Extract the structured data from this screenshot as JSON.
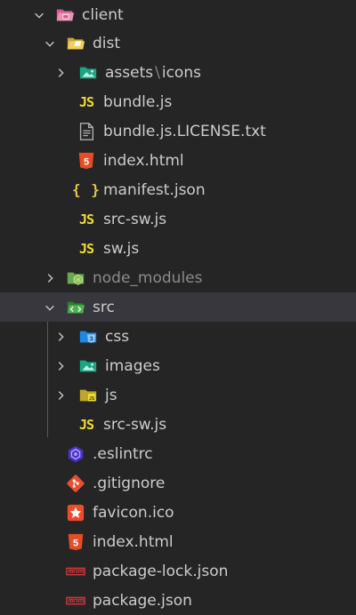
{
  "tree": {
    "client": "client",
    "dist": "dist",
    "assets_a": "assets",
    "assets_b": "icons",
    "bundle_js": "bundle.js",
    "bundle_license": "bundle.js.LICENSE.txt",
    "dist_index": "index.html",
    "manifest": "manifest.json",
    "dist_src_sw": "src-sw.js",
    "sw": "sw.js",
    "node_modules": "node_modules",
    "src": "src",
    "css": "css",
    "images": "images",
    "js": "js",
    "src_src_sw": "src-sw.js",
    "eslintrc": ".eslintrc",
    "gitignore": ".gitignore",
    "favicon": "favicon.ico",
    "index": "index.html",
    "package_lock": "package-lock.json",
    "package": "package.json"
  },
  "icons": {
    "js_glyph": "JS",
    "json_glyph": "{ }",
    "html_glyph": "5",
    "css_glyph": "3"
  },
  "colors": {
    "background": "#252526",
    "selected_row": "#37373d",
    "text": "#cccccc",
    "dim_text": "#8b8b8b"
  }
}
